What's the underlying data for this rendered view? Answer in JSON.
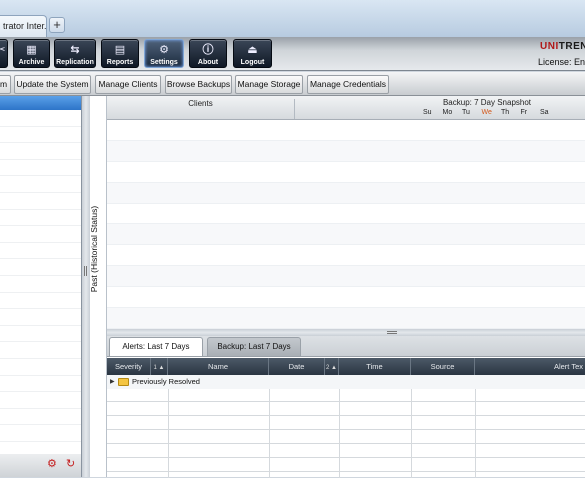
{
  "browser": {
    "tab_title": "trator Inter...",
    "new_tab_symbol": "+"
  },
  "toolbar": {
    "buttons": [
      {
        "label": "",
        "icon": "cut-icon"
      },
      {
        "label": "Archive",
        "icon": "archive-icon"
      },
      {
        "label": "Replication",
        "icon": "replication-icon"
      },
      {
        "label": "Reports",
        "icon": "reports-icon"
      },
      {
        "label": "Settings",
        "icon": "gear-icon"
      },
      {
        "label": "About",
        "icon": "info-icon"
      },
      {
        "label": "Logout",
        "icon": "logout-icon"
      }
    ],
    "brand_prefix": "UNI",
    "brand_suffix": "TREN",
    "license": "License: Ente",
    "colors": {
      "button_bg": "#14202f",
      "brand_red": "#b01818"
    }
  },
  "submenu": {
    "items": [
      "m",
      "Update the System",
      "Manage Clients",
      "Browse Backups",
      "Manage Storage",
      "Manage Credentials"
    ]
  },
  "side_panel": {
    "vertical_label": "Past (Historical Status)"
  },
  "main_grid": {
    "clients_header": "Clients",
    "backup_header": "Backup: 7 Day Snapshot",
    "days": [
      "Su",
      "Mo",
      "Tu",
      "We",
      "Th",
      "Fr",
      "Sa"
    ],
    "highlight_day": "We",
    "highlight_color": "#d2581a"
  },
  "bottom": {
    "tabs": [
      {
        "label": "Alerts: Last 7 Days",
        "active": true
      },
      {
        "label": "Backup: Last 7 Days",
        "active": false
      }
    ],
    "columns": [
      {
        "label": "Severity",
        "sort": "1 ▲"
      },
      {
        "label": "Name",
        "sort": ""
      },
      {
        "label": "Date",
        "sort": "2 ▲"
      },
      {
        "label": "Time",
        "sort": ""
      },
      {
        "label": "Source",
        "sort": ""
      },
      {
        "label": "Alert Tex",
        "sort": ""
      }
    ],
    "group_row": "Previously Resolved"
  }
}
